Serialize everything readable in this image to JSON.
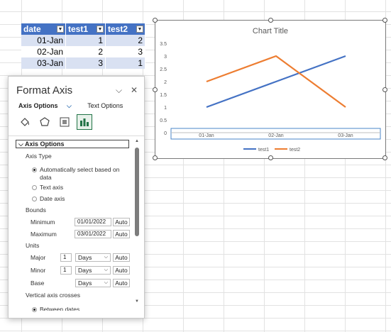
{
  "table": {
    "headers": [
      "date",
      "test1",
      "test2"
    ],
    "rows": [
      [
        "01-Jan",
        "1",
        "2"
      ],
      [
        "02-Jan",
        "2",
        "3"
      ],
      [
        "03-Jan",
        "3",
        "1"
      ]
    ]
  },
  "chart_data": {
    "type": "line",
    "title": "Chart Title",
    "categories": [
      "01-Jan",
      "02-Jan",
      "03-Jan"
    ],
    "series": [
      {
        "name": "test1",
        "values": [
          1,
          2,
          3
        ],
        "color": "#4472c4"
      },
      {
        "name": "test2",
        "values": [
          2,
          3,
          1
        ],
        "color": "#ed7d31"
      }
    ],
    "yticks": [
      "0",
      "0.5",
      "1",
      "1.5",
      "2",
      "2.5",
      "3",
      "3.5"
    ],
    "ylim": [
      0,
      3.5
    ],
    "grid": false,
    "legend": "bottom"
  },
  "pane": {
    "title": "Format Axis",
    "tab_axis": "Axis Options",
    "tab_text": "Text Options",
    "section": "Axis Options",
    "axis_type_label": "Axis Type",
    "auto_select": "Automatically select based on",
    "auto_select2": "data",
    "text_axis": "Text axis",
    "date_axis": "Date axis",
    "bounds_label": "Bounds",
    "minimum_label": "Minimum",
    "minimum_value": "01/01/2022",
    "maximum_label": "Maximum",
    "maximum_value": "03/01/2022",
    "auto": "Auto",
    "units_label": "Units",
    "major_label": "Major",
    "major_value": "1",
    "minor_label": "Minor",
    "minor_value": "1",
    "base_label": "Base",
    "days": "Days",
    "crosses_label": "Vertical axis crosses",
    "between_dates": "Between dates"
  }
}
